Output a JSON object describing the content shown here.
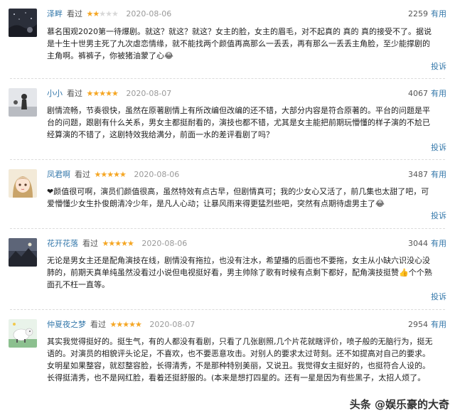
{
  "labels": {
    "watched": "看过",
    "useful": "有用",
    "report": "投诉"
  },
  "colors": {
    "link": "#3377aa",
    "star_on": "#f5a623",
    "star_off": "#d8d8d8"
  },
  "reviews": [
    {
      "user": "泽畔",
      "rating": 2,
      "date": "2020-08-06",
      "votes": "2259",
      "avatar_icon": "night-sky-avatar",
      "content": "慕名围观2020第一待爆剧。就这？就这？就这？女主的脸，女主的眉毛，对不起真的 真的 真的接受不了。据说是十生十世男主死了九次虐恋情缘，就不能找两个颜值再高那么一丢丢，再有那么一丢丢主角脸，至少能撑剧的主角啊。裤裤子，你被猪油蒙了心😂"
    },
    {
      "user": "小小",
      "rating": 5,
      "date": "2020-08-07",
      "votes": "4067",
      "avatar_icon": "silhouette-avatar",
      "content": "剧情流畅，节奏很快，虽然在原著剧情上有所改编但改编的还不错，大部分内容是符合原著的。平台的问题是平台的问题，跟剧有什么关系，男女主都挺耐看的，演技也都不错，尤其是女主能把前期玩懵懂的样子演的不尬已经算演的不错了，这剧特效我给满分，前面一水的差评看剧了吗？"
    },
    {
      "user": "凤君啊",
      "rating": 5,
      "date": "2020-08-06",
      "votes": "3487",
      "avatar_icon": "anime-girl-avatar",
      "content": "❤颜值很可啊，演员们颜值很高，虽然特效有点古早，但剧情真可；我的少女心又活了，前几集也太甜了吧，可爱懵懂少女生扑俊朗清冷少年，是凡人心动；让暴风雨来得更猛烈些吧，突然有点期待虐男主了😂"
    },
    {
      "user": "花开花落",
      "rating": 5,
      "date": "2020-08-06",
      "votes": "3044",
      "avatar_icon": "mountain-dusk-avatar",
      "content": "无论是男女主还是配角演技在线，剧情没有拖拉，也没有注水，希望播的后面也不要拖，女主从小缺六识没心没肺的，前期天真单纯虽然没看过小说但电视挺好看，男主帅除了歌有时候有点剩下都好，配角演技挺赞👍个个熟面孔不枉一直等。"
    },
    {
      "user": "仲夏夜之梦",
      "rating": 5,
      "date": "2020-08-07",
      "votes": "2954",
      "avatar_icon": "cartoon-sheep-avatar",
      "content": "其实我觉得挺好的。挺生气，有的人都没有看剧，只看了几张剧照,几个片花就瞎评价，喷子般的无脑行为，挺无语的。对演员的相貌评头论足，不喜欢，也不要恶意攻击。对别人的要求太过苛刻。还不如提高对自己的要求。女明星如果整容，就怼整容脸，长得清秀，不是那种特别美丽，又说丑。我觉得女主挺好的，也挺符合人设的。长得挺清秀，也不是网红脸，看着还挺舒服的。(本来是想打四星的。还有一星是因为有些黑子，太招人烦了。"
    }
  ],
  "watermark": "头条 @娱乐豪的大奇"
}
